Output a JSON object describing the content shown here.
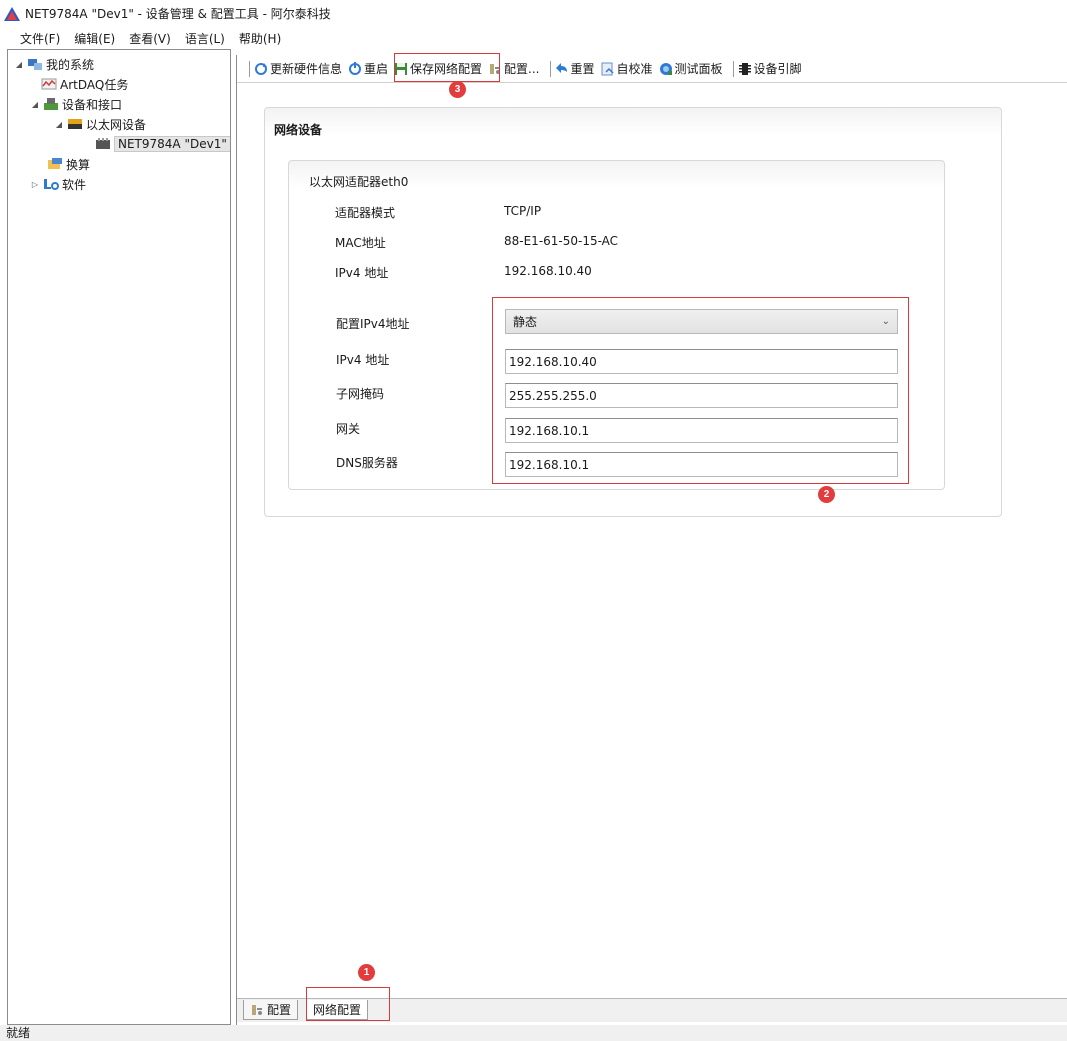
{
  "window": {
    "title": "NET9784A \"Dev1\" - 设备管理 & 配置工具 - 阿尔泰科技"
  },
  "menu": {
    "items": [
      {
        "label": "文件(F)"
      },
      {
        "label": "编辑(E)"
      },
      {
        "label": "查看(V)"
      },
      {
        "label": "语言(L)"
      },
      {
        "label": "帮助(H)"
      }
    ]
  },
  "tree": {
    "items": [
      {
        "label": "我的系统",
        "icon": "system-icon",
        "expanded": true
      },
      {
        "label": "ArtDAQ任务",
        "icon": "task-icon"
      },
      {
        "label": "设备和接口",
        "icon": "devices-icon",
        "expanded": true
      },
      {
        "label": "以太网设备",
        "icon": "ethernet-icon",
        "expanded": true
      },
      {
        "label": "NET9784A \"Dev1\"",
        "icon": "device-icon",
        "selected": true
      },
      {
        "label": "换算",
        "icon": "scale-icon"
      },
      {
        "label": "软件",
        "icon": "software-icon",
        "expanded": false
      }
    ]
  },
  "toolbar": {
    "refresh_label": "更新硬件信息",
    "restart_label": "重启",
    "save_network_label": "保存网络配置",
    "config_label": "配置...",
    "reset_label": "重置",
    "selfcal_label": "自校准",
    "testpanel_label": "测试面板",
    "pins_label": "设备引脚"
  },
  "network": {
    "section_title": "网络设备",
    "adapter_title": "以太网适配器eth0",
    "info": [
      {
        "label": "适配器模式",
        "value": "TCP/IP"
      },
      {
        "label": "MAC地址",
        "value": "88-E1-61-50-15-AC"
      },
      {
        "label": "IPv4 地址",
        "value": "192.168.10.40"
      }
    ],
    "config_ipv4_label": "配置IPv4地址",
    "config_ipv4_value": "静态",
    "ipv4_label": "IPv4 地址",
    "ipv4_value": "192.168.10.40",
    "subnet_label": "子网掩码",
    "subnet_value": "255.255.255.0",
    "gateway_label": "网关",
    "gateway_value": "192.168.10.1",
    "dns_label": "DNS服务器",
    "dns_value": "192.168.10.1"
  },
  "annotations": {
    "badge1": "1",
    "badge2": "2",
    "badge3": "3",
    "color": "#d63b3b"
  },
  "tabs": {
    "config_label": "配置",
    "network_label": "网络配置",
    "active": "网络配置"
  },
  "status": {
    "text": "就绪"
  }
}
